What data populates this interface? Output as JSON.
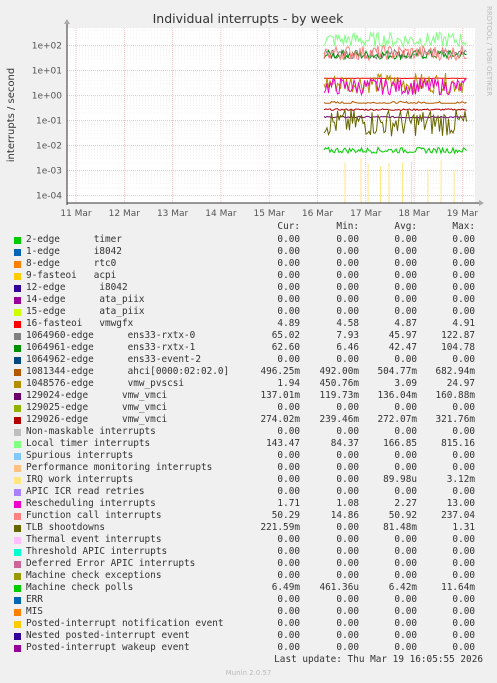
{
  "chart_data": {
    "type": "line",
    "title": "Individual interrupts - by week",
    "ylabel": "interrupts / second",
    "yscale": "log",
    "ylim": [
      5e-05,
      500
    ],
    "yticks": [
      "1e+02",
      "1e+01",
      "1e+00",
      "1e-01",
      "1e-02",
      "1e-03",
      "1e-04"
    ],
    "xticks": [
      "11 Mar",
      "12 Mar",
      "13 Mar",
      "14 Mar",
      "15 Mar",
      "16 Mar",
      "17 Mar",
      "18 Mar",
      "19 Mar"
    ],
    "grid": true,
    "columns": [
      "Cur:",
      "Min:",
      "Avg:",
      "Max:"
    ],
    "series": [
      {
        "name": "2-edge      timer",
        "color": "#00cc00",
        "cur": "0.00",
        "min": "0.00",
        "avg": "0.00",
        "max": "0.00"
      },
      {
        "name": "1-edge      i8042",
        "color": "#0066b3",
        "cur": "0.00",
        "min": "0.00",
        "avg": "0.00",
        "max": "0.00"
      },
      {
        "name": "8-edge      rtc0",
        "color": "#ff8000",
        "cur": "0.00",
        "min": "0.00",
        "avg": "0.00",
        "max": "0.00"
      },
      {
        "name": "9-fasteoi   acpi",
        "color": "#ffcc00",
        "cur": "0.00",
        "min": "0.00",
        "avg": "0.00",
        "max": "0.00"
      },
      {
        "name": "12-edge      i8042",
        "color": "#330099",
        "cur": "0.00",
        "min": "0.00",
        "avg": "0.00",
        "max": "0.00"
      },
      {
        "name": "14-edge      ata_piix",
        "color": "#990099",
        "cur": "0.00",
        "min": "0.00",
        "avg": "0.00",
        "max": "0.00"
      },
      {
        "name": "15-edge      ata_piix",
        "color": "#ccff00",
        "cur": "0.00",
        "min": "0.00",
        "avg": "0.00",
        "max": "0.00"
      },
      {
        "name": "16-fasteoi   vmwgfx",
        "color": "#ff0000",
        "cur": "4.89",
        "min": "4.58",
        "avg": "4.87",
        "max": "4.91"
      },
      {
        "name": "1064960-edge      ens33-rxtx-0",
        "color": "#808080",
        "cur": "65.02",
        "min": "7.93",
        "avg": "45.97",
        "max": "122.87"
      },
      {
        "name": "1064961-edge      ens33-rxtx-1",
        "color": "#008f00",
        "cur": "62.60",
        "min": "6.46",
        "avg": "42.47",
        "max": "104.78"
      },
      {
        "name": "1064962-edge      ens33-event-2",
        "color": "#00487d",
        "cur": "0.00",
        "min": "0.00",
        "avg": "0.00",
        "max": "0.00"
      },
      {
        "name": "1081344-edge      ahci[0000:02:02.0]",
        "color": "#b35a00",
        "cur": "496.25m",
        "min": "492.00m",
        "avg": "504.77m",
        "max": "682.94m"
      },
      {
        "name": "1048576-edge      vmw_pvscsi",
        "color": "#b38f00",
        "cur": "1.94",
        "min": "450.76m",
        "avg": "3.09",
        "max": "24.97"
      },
      {
        "name": "129024-edge      vmw_vmci",
        "color": "#6b006b",
        "cur": "137.01m",
        "min": "119.73m",
        "avg": "136.04m",
        "max": "160.88m"
      },
      {
        "name": "129025-edge      vmw_vmci",
        "color": "#8fb300",
        "cur": "0.00",
        "min": "0.00",
        "avg": "0.00",
        "max": "0.00"
      },
      {
        "name": "129026-edge      vmw_vmci",
        "color": "#b30000",
        "cur": "274.02m",
        "min": "239.46m",
        "avg": "272.07m",
        "max": "321.76m"
      },
      {
        "name": "Non-maskable interrupts",
        "color": "#bebebe",
        "cur": "0.00",
        "min": "0.00",
        "avg": "0.00",
        "max": "0.00"
      },
      {
        "name": "Local timer interrupts",
        "color": "#80ff80",
        "cur": "143.47",
        "min": "84.37",
        "avg": "166.85",
        "max": "815.16"
      },
      {
        "name": "Spurious interrupts",
        "color": "#80c9ff",
        "cur": "0.00",
        "min": "0.00",
        "avg": "0.00",
        "max": "0.00"
      },
      {
        "name": "Performance monitoring interrupts",
        "color": "#ffc080",
        "cur": "0.00",
        "min": "0.00",
        "avg": "0.00",
        "max": "0.00"
      },
      {
        "name": "IRQ work interrupts",
        "color": "#ffe680",
        "cur": "0.00",
        "min": "0.00",
        "avg": "89.98u",
        "max": "3.12m"
      },
      {
        "name": "APIC ICR read retries",
        "color": "#aa80ff",
        "cur": "0.00",
        "min": "0.00",
        "avg": "0.00",
        "max": "0.00"
      },
      {
        "name": "Rescheduling interrupts",
        "color": "#ee00cc",
        "cur": "1.71",
        "min": "1.08",
        "avg": "2.27",
        "max": "13.00"
      },
      {
        "name": "Function call interrupts",
        "color": "#ff8080",
        "cur": "50.29",
        "min": "14.86",
        "avg": "50.92",
        "max": "237.04"
      },
      {
        "name": "TLB shootdowns",
        "color": "#666600",
        "cur": "221.59m",
        "min": "0.00",
        "avg": "81.48m",
        "max": "1.31"
      },
      {
        "name": "Thermal event interrupts",
        "color": "#ffbfff",
        "cur": "0.00",
        "min": "0.00",
        "avg": "0.00",
        "max": "0.00"
      },
      {
        "name": "Threshold APIC interrupts",
        "color": "#00ffcc",
        "cur": "0.00",
        "min": "0.00",
        "avg": "0.00",
        "max": "0.00"
      },
      {
        "name": "Deferred Error APIC interrupts",
        "color": "#cc6699",
        "cur": "0.00",
        "min": "0.00",
        "avg": "0.00",
        "max": "0.00"
      },
      {
        "name": "Machine check exceptions",
        "color": "#999900",
        "cur": "0.00",
        "min": "0.00",
        "avg": "0.00",
        "max": "0.00"
      },
      {
        "name": "Machine check polls",
        "color": "#00cc00",
        "cur": "6.49m",
        "min": "461.36u",
        "avg": "6.42m",
        "max": "11.64m"
      },
      {
        "name": "ERR",
        "color": "#0066b3",
        "cur": "0.00",
        "min": "0.00",
        "avg": "0.00",
        "max": "0.00"
      },
      {
        "name": "MIS",
        "color": "#ff8000",
        "cur": "0.00",
        "min": "0.00",
        "avg": "0.00",
        "max": "0.00"
      },
      {
        "name": "Posted-interrupt notification event",
        "color": "#ffcc00",
        "cur": "0.00",
        "min": "0.00",
        "avg": "0.00",
        "max": "0.00"
      },
      {
        "name": "Nested posted-interrupt event",
        "color": "#330099",
        "cur": "0.00",
        "min": "0.00",
        "avg": "0.00",
        "max": "0.00"
      },
      {
        "name": "Posted-interrupt wakeup event",
        "color": "#990099",
        "cur": "0.00",
        "min": "0.00",
        "avg": "0.00",
        "max": "0.00"
      }
    ]
  },
  "footer": {
    "last_update": "Last update: Thu Mar 19 16:05:55 2026",
    "munin": "Munin 2.0.57"
  },
  "side_label": "RRDTOOL / TOBI OETIKER"
}
